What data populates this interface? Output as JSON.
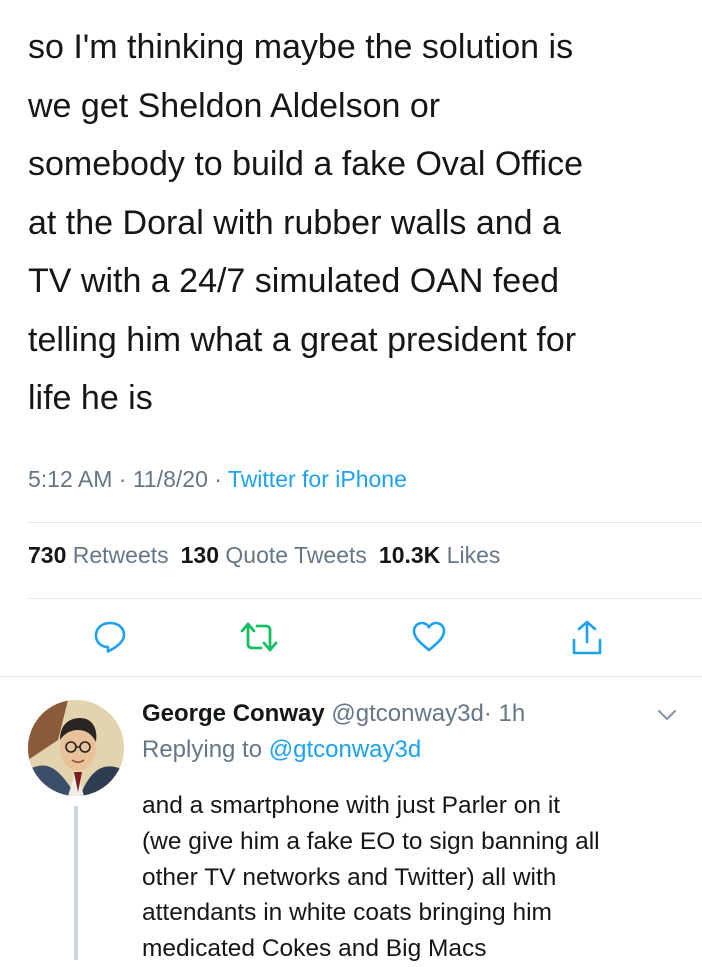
{
  "tweet": {
    "lines": [
      "so I'm thinking maybe the solution is",
      "we get Sheldon Aldelson or",
      "somebody to build a fake Oval Office",
      "at the Doral with rubber walls and a",
      "TV with a 24/7 simulated OAN feed",
      "telling him what a great president for",
      "life he is"
    ],
    "time": "5:12 AM",
    "date": "11/8/20",
    "separator": "·",
    "source": "Twitter for iPhone"
  },
  "stats": {
    "retweets_count": "730",
    "retweets_label": "Retweets",
    "quotes_count": "130",
    "quotes_label": "Quote Tweets",
    "likes_count": "10.3K",
    "likes_label": "Likes"
  },
  "actions": {
    "reply_icon": "reply-icon",
    "retweet_icon": "retweet-icon",
    "like_icon": "heart-icon",
    "share_icon": "share-icon",
    "retweet_color": "#17bf63",
    "icon_color": "#1da1f2"
  },
  "reply": {
    "name": "George Conway",
    "handle": "@gtconway3d",
    "separator": "·",
    "age": "1h",
    "replying_prefix": "Replying to",
    "replying_to": "@gtconway3d",
    "lines": [
      "and a smartphone with just Parler on it",
      "(we give him a fake EO to sign banning all",
      "other TV networks and Twitter) all with",
      "attendants in white coats bringing him",
      "medicated Cokes and Big Macs"
    ]
  }
}
